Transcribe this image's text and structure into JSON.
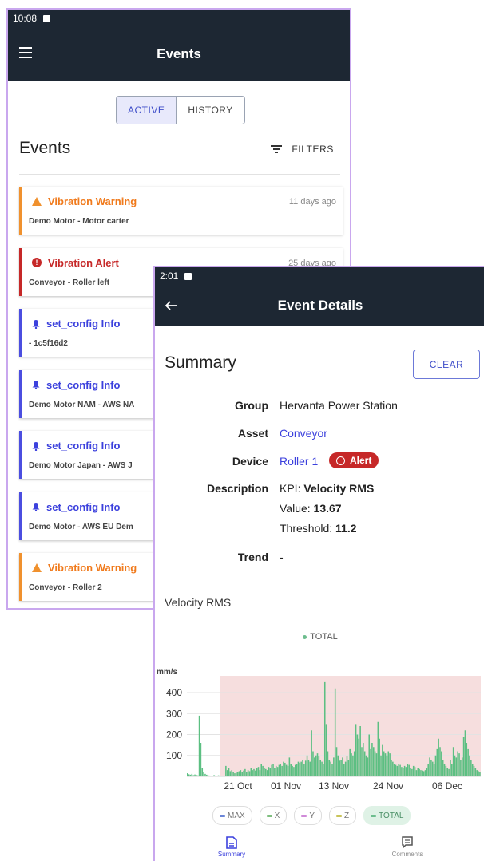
{
  "events_screen": {
    "status_time": "10:08",
    "title": "Events",
    "toggle": {
      "active": "ACTIVE",
      "history": "HISTORY"
    },
    "heading": "Events",
    "filters_label": "FILTERS",
    "events": [
      {
        "type": "warning",
        "title": "Vibration Warning",
        "subtitle": "Demo Motor - Motor carter",
        "time": "11 days ago"
      },
      {
        "type": "alert",
        "title": "Vibration Alert",
        "subtitle": "Conveyor - Roller left",
        "time": "25 days ago"
      },
      {
        "type": "info",
        "title": "set_config Info",
        "subtitle": "- 1c5f16d2",
        "time": ""
      },
      {
        "type": "info",
        "title": "set_config Info",
        "subtitle": "Demo Motor NAM - AWS NA",
        "time": ""
      },
      {
        "type": "info",
        "title": "set_config Info",
        "subtitle": "Demo Motor Japan - AWS J",
        "time": ""
      },
      {
        "type": "info",
        "title": "set_config Info",
        "subtitle": "Demo Motor - AWS EU Dem",
        "time": ""
      },
      {
        "type": "warning",
        "title": "Vibration Warning",
        "subtitle": "Conveyor - Roller 2",
        "time": ""
      }
    ]
  },
  "details_screen": {
    "status_time": "2:01",
    "title": "Event Details",
    "summary_title": "Summary",
    "clear_label": "CLEAR",
    "fields": {
      "group_label": "Group",
      "group_value": "Hervanta Power Station",
      "asset_label": "Asset",
      "asset_value": "Conveyor",
      "device_label": "Device",
      "device_value": "Roller 1",
      "alert_badge": "Alert",
      "description_label": "Description",
      "kpi_prefix": "KPI: ",
      "kpi_value": "Velocity RMS",
      "value_prefix": "Value: ",
      "value_value": "13.67",
      "threshold_prefix": "Threshold: ",
      "threshold_value": "11.2",
      "trend_label": "Trend",
      "trend_value": "-"
    },
    "chart_title": "Velocity RMS",
    "legend_total": "TOTAL",
    "chips": [
      {
        "label": "MAX",
        "color": "#6b86d8",
        "selected": false
      },
      {
        "label": "X",
        "color": "#7fbf7f",
        "selected": false
      },
      {
        "label": "Y",
        "color": "#d08ad8",
        "selected": false
      },
      {
        "label": "Z",
        "color": "#c9c45a",
        "selected": false
      },
      {
        "label": "TOTAL",
        "color": "#6dbd8e",
        "selected": true
      }
    ],
    "nav": {
      "summary": "Summary",
      "comments": "Comments"
    }
  },
  "colors": {
    "appbar": "#1d2733",
    "warning": "#f0912e",
    "alert": "#c62828",
    "info": "#3c41dd",
    "series": "#5cbf82",
    "alert_zone": "#f6dede"
  },
  "chart_data": {
    "type": "bar",
    "title": "Velocity RMS",
    "ylabel": "mm/s",
    "ylim": [
      0,
      480
    ],
    "yticks": [
      100,
      200,
      300,
      400
    ],
    "xticks": [
      "21 Oct",
      "01 Nov",
      "13 Nov",
      "24 Nov",
      "06 Dec"
    ],
    "alert_zone": true,
    "series": [
      {
        "name": "TOTAL",
        "values": [
          15,
          10,
          8,
          12,
          6,
          9,
          7,
          5,
          290,
          160,
          40,
          20,
          12,
          8,
          5,
          4,
          3,
          2,
          6,
          4,
          3,
          5,
          4,
          3,
          3,
          2,
          50,
          30,
          40,
          25,
          30,
          20,
          15,
          18,
          20,
          25,
          30,
          22,
          28,
          35,
          20,
          30,
          25,
          40,
          30,
          35,
          28,
          40,
          45,
          30,
          60,
          50,
          40,
          35,
          30,
          45,
          38,
          55,
          60,
          40,
          50,
          45,
          55,
          60,
          50,
          70,
          65,
          55,
          50,
          90,
          60,
          50,
          45,
          55,
          60,
          70,
          65,
          70,
          80,
          60,
          75,
          100,
          80,
          70,
          220,
          120,
          90,
          100,
          110,
          95,
          80,
          70,
          60,
          450,
          250,
          120,
          80,
          70,
          60,
          90,
          420,
          140,
          100,
          75,
          80,
          90,
          60,
          70,
          95,
          80,
          130,
          110,
          100,
          120,
          250,
          200,
          180,
          240,
          140,
          160,
          120,
          100,
          90,
          200,
          130,
          160,
          140,
          120,
          110,
          260,
          180,
          100,
          150,
          120,
          110,
          100,
          120,
          110,
          80,
          70,
          60,
          55,
          50,
          60,
          55,
          45,
          40,
          50,
          45,
          60,
          55,
          40,
          35,
          50,
          45,
          30,
          40,
          35,
          30,
          28,
          25,
          30,
          40,
          60,
          90,
          80,
          70,
          60,
          100,
          130,
          180,
          140,
          120,
          80,
          60,
          50,
          40,
          35,
          80,
          60,
          140,
          100,
          90,
          120,
          110,
          80,
          90,
          190,
          220,
          160,
          130,
          100,
          80,
          60,
          50,
          40,
          30,
          25,
          20
        ]
      }
    ]
  }
}
